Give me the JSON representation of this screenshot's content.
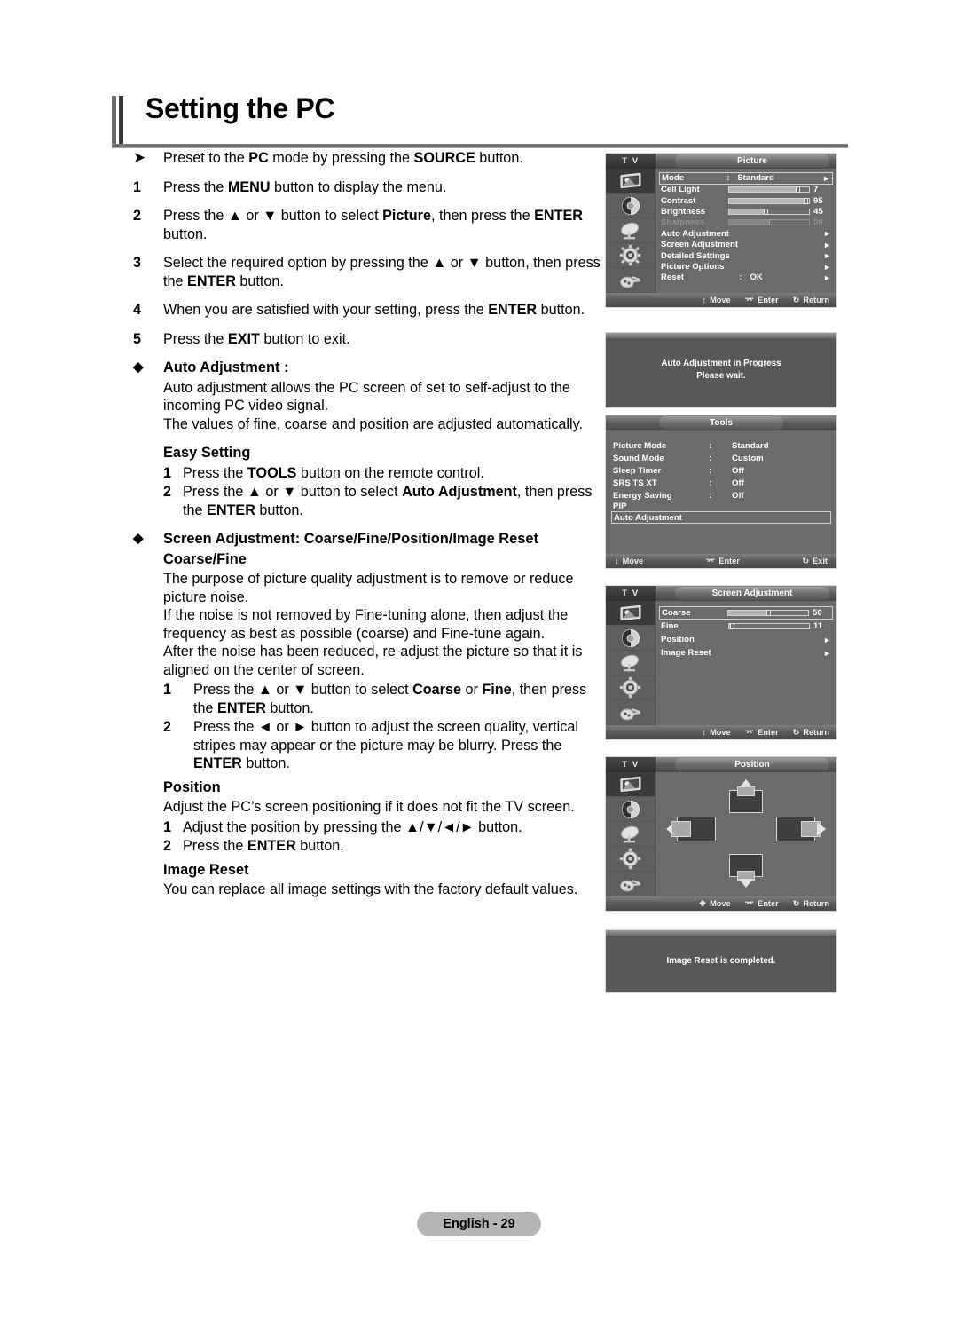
{
  "page": {
    "title": "Setting the PC",
    "footer_badge": "English - 29"
  },
  "instructions": {
    "preset": {
      "marker": "➤",
      "text_parts": [
        "Preset to the ",
        "PC",
        " mode by pressing the ",
        "SOURCE",
        " button."
      ]
    },
    "steps": [
      {
        "n": "1",
        "parts": [
          "Press the ",
          "MENU",
          " button to display the menu."
        ]
      },
      {
        "n": "2",
        "parts": [
          "Press the ▲ or ▼ button to select ",
          "Picture",
          ", then press the ",
          "ENTER",
          " button."
        ]
      },
      {
        "n": "3",
        "parts": [
          "Select the required option by pressing the ▲ or ▼ button, then press the ",
          "ENTER",
          " button."
        ]
      },
      {
        "n": "4",
        "parts": [
          "When you are satisfied with your setting, press the ",
          "ENTER",
          " button."
        ]
      },
      {
        "n": "5",
        "parts": [
          "Press the ",
          "EXIT",
          " button to exit."
        ]
      }
    ],
    "auto_adjustment": {
      "marker": "◆",
      "heading": "Auto Adjustment :",
      "body_line1": "Auto adjustment allows the PC screen of set to self-adjust to the incoming PC video signal.",
      "body_line2": "The values of fine, coarse and position are adjusted automatically."
    },
    "easy_setting": {
      "heading": "Easy Setting",
      "steps": [
        {
          "n": "1",
          "parts": [
            "Press the ",
            "TOOLS",
            " button on the remote control."
          ]
        },
        {
          "n": "2",
          "parts": [
            "Press the ▲ or ▼ button to select ",
            "Auto Adjustment",
            ", then press the ",
            "ENTER",
            " button."
          ]
        }
      ]
    },
    "screen_adjustment": {
      "marker": "◆",
      "heading": "Screen Adjustment: Coarse/Fine/Position/Image Reset",
      "coarse_fine": {
        "heading": "Coarse/Fine",
        "p1": "The purpose of picture quality adjustment is to remove or reduce picture noise.",
        "p2": "If the noise is not removed by Fine-tuning alone, then adjust the frequency as best as possible (coarse) and Fine-tune again.",
        "p3": "After the noise has been reduced, re-adjust the picture so that it is aligned on the center of screen.",
        "steps": [
          {
            "n": "1",
            "parts": [
              "Press the ▲ or ▼ button to select ",
              "Coarse",
              " or ",
              "Fine",
              ", then press the ",
              "ENTER",
              " button."
            ]
          },
          {
            "n": "2",
            "parts": [
              "Press the ◄ or ► button to adjust the screen quality, vertical stripes may appear or the picture may be blurry. Press the ",
              "ENTER",
              " button."
            ]
          }
        ]
      },
      "position": {
        "heading": "Position",
        "p1": "Adjust the PC’s screen positioning if it does not fit the TV screen.",
        "steps": [
          {
            "n": "1",
            "parts": [
              "Adjust the position by pressing the ▲/▼/◄/► button."
            ]
          },
          {
            "n": "2",
            "parts": [
              "Press the ",
              "ENTER",
              " button."
            ]
          }
        ]
      },
      "image_reset": {
        "heading": "Image Reset",
        "p1": "You can replace all image settings with the factory default values."
      }
    }
  },
  "osd": {
    "sidebar_icons": [
      "picture-icon",
      "sound-icon",
      "channel-dish-icon",
      "setup-gear-icon",
      "input-plug-icon"
    ],
    "tv_label": "T V",
    "footer": {
      "move": "Move",
      "enter": "Enter",
      "return": "Return",
      "exit": "Exit"
    },
    "picture_menu": {
      "title": "Picture",
      "rows": [
        {
          "label": "Mode",
          "type": "value",
          "value": "Standard",
          "colon": ":",
          "arrow": true,
          "selected": true
        },
        {
          "label": "Cell Light",
          "type": "slider",
          "value": "7",
          "pct": 85
        },
        {
          "label": "Contrast",
          "type": "slider",
          "value": "95",
          "pct": 97
        },
        {
          "label": "Brightness",
          "type": "slider",
          "value": "45",
          "pct": 45
        },
        {
          "label": "Sharpness",
          "type": "slider",
          "value": "50",
          "pct": 52,
          "dim": true
        },
        {
          "label": "Auto Adjustment",
          "type": "arrow"
        },
        {
          "label": "Screen Adjustment",
          "type": "arrow"
        },
        {
          "label": "Detailed Settings",
          "type": "arrow"
        },
        {
          "label": "Picture Options",
          "type": "arrow"
        },
        {
          "label": "Reset",
          "type": "value",
          "value": "OK",
          "colon": ":",
          "arrow": true
        }
      ]
    },
    "auto_adjust_dialog": {
      "line1": "Auto Adjustment in Progress",
      "line2": "Please wait."
    },
    "tools_menu": {
      "title": "Tools",
      "rows": [
        {
          "label": "Picture Mode",
          "colon": ":",
          "value": "Standard"
        },
        {
          "label": "Sound Mode",
          "colon": ":",
          "value": "Custom"
        },
        {
          "label": "Sleep Timer",
          "colon": ":",
          "value": "Off"
        },
        {
          "label": "SRS TS XT",
          "colon": ":",
          "value": "Off"
        },
        {
          "label": "Energy Saving",
          "colon": ":",
          "value": "Off"
        },
        {
          "label": "PIP",
          "colon": "",
          "value": ""
        },
        {
          "label": "Auto Adjustment",
          "colon": "",
          "value": "",
          "selected": true
        }
      ]
    },
    "screen_adjustment_menu": {
      "title": "Screen Adjustment",
      "rows": [
        {
          "label": "Coarse",
          "type": "slider",
          "value": "50",
          "pct": 50,
          "selected": true
        },
        {
          "label": "Fine",
          "type": "slider",
          "value": "11",
          "pct": 5
        },
        {
          "label": "Position",
          "type": "arrow"
        },
        {
          "label": "Image Reset",
          "type": "arrow"
        }
      ]
    },
    "position_menu": {
      "title": "Position"
    },
    "image_reset_dialog": {
      "line1": "Image Reset is completed."
    }
  }
}
